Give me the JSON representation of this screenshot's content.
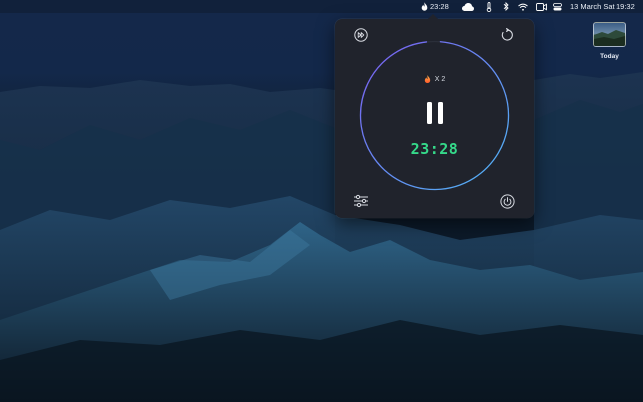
{
  "menubar": {
    "timer_text": "23:28",
    "date_text": "13 March Sat",
    "time_text": "19:32",
    "icons": [
      "flame-icon",
      "cloud-icon",
      "thermometer-icon",
      "bluetooth-icon",
      "wifi-icon",
      "battery-icon",
      "video-icon",
      "control-center-icon"
    ]
  },
  "popover": {
    "streak": {
      "icon": "flame-icon",
      "text": "X 2"
    },
    "timer": "23:28",
    "progress_fraction": 0.97,
    "colors": {
      "ring_start": "#7b5cf0",
      "ring_end": "#4fb7f5",
      "timer": "#35d98a",
      "panel": "#20232c"
    },
    "buttons": [
      "skip-button",
      "reset-button",
      "pause-button",
      "settings-button",
      "power-button"
    ]
  },
  "desktop": {
    "widget_label": "Today"
  }
}
